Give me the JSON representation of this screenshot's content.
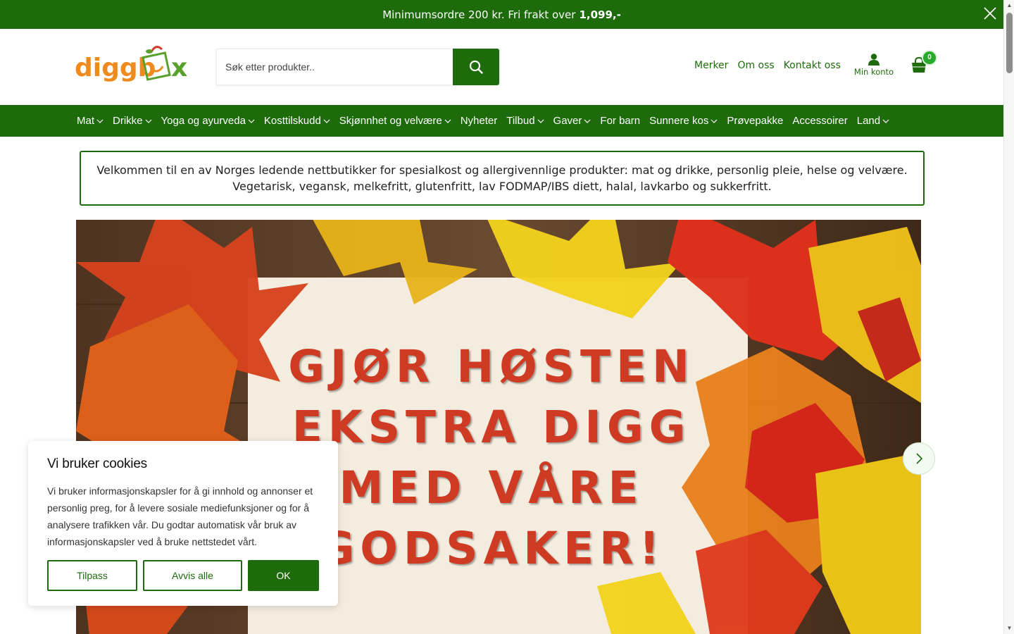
{
  "announcement": {
    "text": "Minimumsordre 200 kr. Fri frakt over",
    "amount": "1,099,-"
  },
  "header": {
    "logo_alt": "diggbox",
    "search_placeholder": "Søk etter produkter..",
    "links": [
      "Merker",
      "Om oss",
      "Kontakt oss"
    ],
    "account_label": "Min konto",
    "cart_count": "0"
  },
  "nav": {
    "items": [
      {
        "label": "Mat",
        "dropdown": true
      },
      {
        "label": "Drikke",
        "dropdown": true
      },
      {
        "label": "Yoga og ayurveda",
        "dropdown": true
      },
      {
        "label": "Kosttilskudd",
        "dropdown": true
      },
      {
        "label": "Skjønnhet og velvære",
        "dropdown": true
      },
      {
        "label": "Nyheter",
        "dropdown": false
      },
      {
        "label": "Tilbud",
        "dropdown": true
      },
      {
        "label": "Gaver",
        "dropdown": true
      },
      {
        "label": "For barn",
        "dropdown": false
      },
      {
        "label": "Sunnere kos",
        "dropdown": true
      },
      {
        "label": "Prøvepakke",
        "dropdown": false
      },
      {
        "label": "Accessoirer",
        "dropdown": false
      },
      {
        "label": "Land",
        "dropdown": true
      }
    ]
  },
  "welcome": {
    "line1": "Velkommen til en av Norges ledende nettbutikker for spesialkost og allergivennlige produkter: mat og drikke, personlig pleie, helse og velvære.",
    "line2": "Vegetarisk, vegansk, melkefritt, glutenfritt, lav FODMAP/IBS diett, halal, lavkarbo og sukkerfritt."
  },
  "hero": {
    "lines": [
      "GJØR HØSTEN",
      "EKSTRA DIGG",
      "MED VÅRE",
      "GODSAKER!"
    ]
  },
  "cookie": {
    "title": "Vi bruker cookies",
    "body": "Vi bruker informasjonskapsler for å gi innhold og annonser et personlig preg, for å levere sosiale mediefunksjoner og for å analysere trafikken vår. Du godtar automatisk vår bruk av informasjonskapsler ved å bruke nettstedet vårt.",
    "customize": "Tilpass",
    "reject": "Avvis alle",
    "accept": "OK"
  },
  "colors": {
    "brand_green": "#1e6b0c",
    "hero_text": "#cf3a22"
  }
}
